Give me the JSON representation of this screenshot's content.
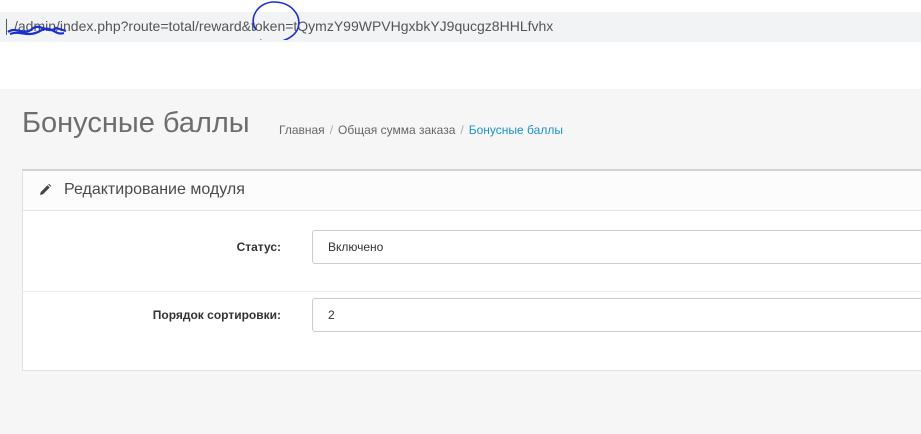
{
  "browser": {
    "url": "/admin/index.php?route=total/reward&token=tQymzY99WPVHgxbkYJ9qucgz8HHLfvhx"
  },
  "header": {
    "title": "Бонусные баллы",
    "breadcrumb": [
      "Главная",
      "Общая сумма заказа",
      "Бонусные баллы"
    ]
  },
  "panel": {
    "icon": "pencil-icon",
    "title": "Редактирование модуля",
    "fields": [
      {
        "label": "Статус:",
        "value": "Включено"
      },
      {
        "label": "Порядок сортировки:",
        "value": "2"
      }
    ]
  },
  "colors": {
    "link": "#1e91cf",
    "annotation": "#1a2fd0"
  }
}
